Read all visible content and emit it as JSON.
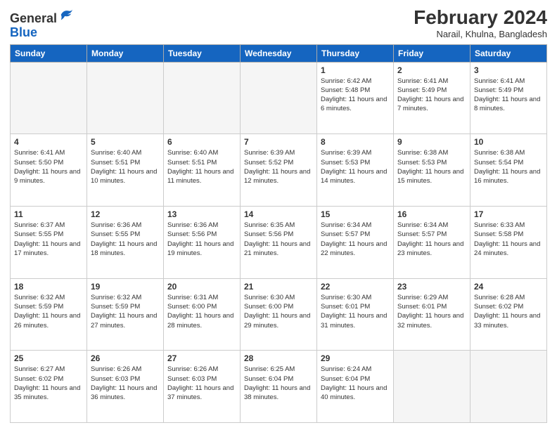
{
  "header": {
    "logo_line1": "General",
    "logo_line2": "Blue",
    "month_year": "February 2024",
    "location": "Narail, Khulna, Bangladesh"
  },
  "weekdays": [
    "Sunday",
    "Monday",
    "Tuesday",
    "Wednesday",
    "Thursday",
    "Friday",
    "Saturday"
  ],
  "rows": [
    [
      {
        "day": "",
        "info": ""
      },
      {
        "day": "",
        "info": ""
      },
      {
        "day": "",
        "info": ""
      },
      {
        "day": "",
        "info": ""
      },
      {
        "day": "1",
        "info": "Sunrise: 6:42 AM\nSunset: 5:48 PM\nDaylight: 11 hours and 6 minutes."
      },
      {
        "day": "2",
        "info": "Sunrise: 6:41 AM\nSunset: 5:49 PM\nDaylight: 11 hours and 7 minutes."
      },
      {
        "day": "3",
        "info": "Sunrise: 6:41 AM\nSunset: 5:49 PM\nDaylight: 11 hours and 8 minutes."
      }
    ],
    [
      {
        "day": "4",
        "info": "Sunrise: 6:41 AM\nSunset: 5:50 PM\nDaylight: 11 hours and 9 minutes."
      },
      {
        "day": "5",
        "info": "Sunrise: 6:40 AM\nSunset: 5:51 PM\nDaylight: 11 hours and 10 minutes."
      },
      {
        "day": "6",
        "info": "Sunrise: 6:40 AM\nSunset: 5:51 PM\nDaylight: 11 hours and 11 minutes."
      },
      {
        "day": "7",
        "info": "Sunrise: 6:39 AM\nSunset: 5:52 PM\nDaylight: 11 hours and 12 minutes."
      },
      {
        "day": "8",
        "info": "Sunrise: 6:39 AM\nSunset: 5:53 PM\nDaylight: 11 hours and 14 minutes."
      },
      {
        "day": "9",
        "info": "Sunrise: 6:38 AM\nSunset: 5:53 PM\nDaylight: 11 hours and 15 minutes."
      },
      {
        "day": "10",
        "info": "Sunrise: 6:38 AM\nSunset: 5:54 PM\nDaylight: 11 hours and 16 minutes."
      }
    ],
    [
      {
        "day": "11",
        "info": "Sunrise: 6:37 AM\nSunset: 5:55 PM\nDaylight: 11 hours and 17 minutes."
      },
      {
        "day": "12",
        "info": "Sunrise: 6:36 AM\nSunset: 5:55 PM\nDaylight: 11 hours and 18 minutes."
      },
      {
        "day": "13",
        "info": "Sunrise: 6:36 AM\nSunset: 5:56 PM\nDaylight: 11 hours and 19 minutes."
      },
      {
        "day": "14",
        "info": "Sunrise: 6:35 AM\nSunset: 5:56 PM\nDaylight: 11 hours and 21 minutes."
      },
      {
        "day": "15",
        "info": "Sunrise: 6:34 AM\nSunset: 5:57 PM\nDaylight: 11 hours and 22 minutes."
      },
      {
        "day": "16",
        "info": "Sunrise: 6:34 AM\nSunset: 5:57 PM\nDaylight: 11 hours and 23 minutes."
      },
      {
        "day": "17",
        "info": "Sunrise: 6:33 AM\nSunset: 5:58 PM\nDaylight: 11 hours and 24 minutes."
      }
    ],
    [
      {
        "day": "18",
        "info": "Sunrise: 6:32 AM\nSunset: 5:59 PM\nDaylight: 11 hours and 26 minutes."
      },
      {
        "day": "19",
        "info": "Sunrise: 6:32 AM\nSunset: 5:59 PM\nDaylight: 11 hours and 27 minutes."
      },
      {
        "day": "20",
        "info": "Sunrise: 6:31 AM\nSunset: 6:00 PM\nDaylight: 11 hours and 28 minutes."
      },
      {
        "day": "21",
        "info": "Sunrise: 6:30 AM\nSunset: 6:00 PM\nDaylight: 11 hours and 29 minutes."
      },
      {
        "day": "22",
        "info": "Sunrise: 6:30 AM\nSunset: 6:01 PM\nDaylight: 11 hours and 31 minutes."
      },
      {
        "day": "23",
        "info": "Sunrise: 6:29 AM\nSunset: 6:01 PM\nDaylight: 11 hours and 32 minutes."
      },
      {
        "day": "24",
        "info": "Sunrise: 6:28 AM\nSunset: 6:02 PM\nDaylight: 11 hours and 33 minutes."
      }
    ],
    [
      {
        "day": "25",
        "info": "Sunrise: 6:27 AM\nSunset: 6:02 PM\nDaylight: 11 hours and 35 minutes."
      },
      {
        "day": "26",
        "info": "Sunrise: 6:26 AM\nSunset: 6:03 PM\nDaylight: 11 hours and 36 minutes."
      },
      {
        "day": "27",
        "info": "Sunrise: 6:26 AM\nSunset: 6:03 PM\nDaylight: 11 hours and 37 minutes."
      },
      {
        "day": "28",
        "info": "Sunrise: 6:25 AM\nSunset: 6:04 PM\nDaylight: 11 hours and 38 minutes."
      },
      {
        "day": "29",
        "info": "Sunrise: 6:24 AM\nSunset: 6:04 PM\nDaylight: 11 hours and 40 minutes."
      },
      {
        "day": "",
        "info": ""
      },
      {
        "day": "",
        "info": ""
      }
    ]
  ]
}
